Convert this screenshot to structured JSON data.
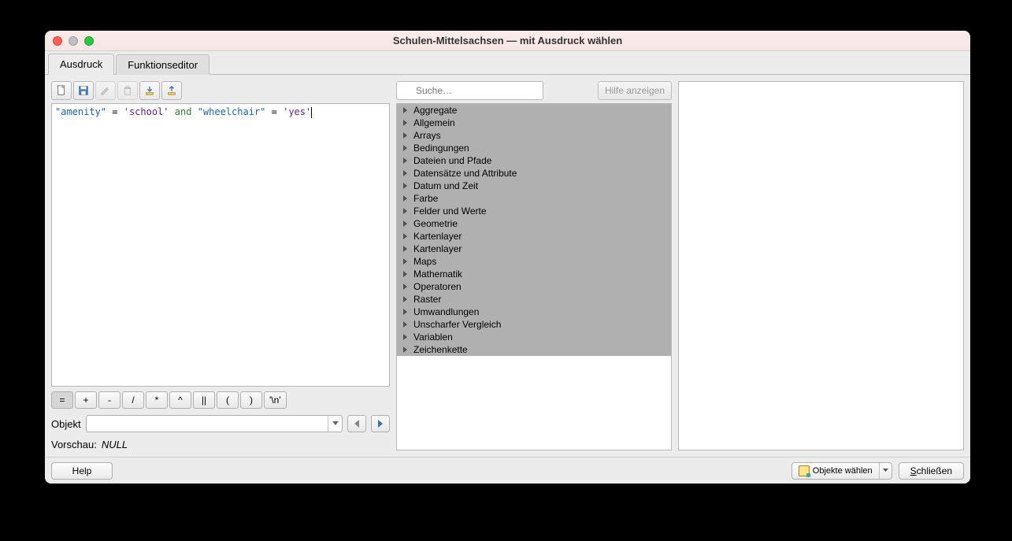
{
  "window": {
    "title": "Schulen-Mittelsachsen — mit Ausdruck wählen"
  },
  "tabs": {
    "expression": "Ausdruck",
    "function_editor": "Funktionseditor"
  },
  "expression": {
    "field1": "\"amenity\"",
    "eq1": "=",
    "str1": "'school'",
    "kw_and": "and",
    "field2": "\"wheelchair\"",
    "eq2": "=",
    "str2": "'yes'"
  },
  "operators": {
    "eq": "=",
    "plus": "+",
    "minus": "-",
    "div": "/",
    "mul": "*",
    "pow": "^",
    "concat": "||",
    "lparen": "(",
    "rparen": ")",
    "newline": "'\\n'"
  },
  "feature": {
    "label": "Objekt"
  },
  "preview": {
    "label": "Vorschau:",
    "value": "NULL"
  },
  "search": {
    "placeholder": "Suche…"
  },
  "help_show": "Hilfe anzeigen",
  "categories": [
    "Aggregate",
    "Allgemein",
    "Arrays",
    "Bedingungen",
    "Dateien und Pfade",
    "Datensätze und Attribute",
    "Datum und Zeit",
    "Farbe",
    "Felder und Werte",
    "Geometrie",
    "Kartenlayer",
    "Kartenlayer",
    "Maps",
    "Mathematik",
    "Operatoren",
    "Raster",
    "Umwandlungen",
    "Unscharfer Vergleich",
    "Variablen",
    "Zeichenkette"
  ],
  "buttons": {
    "help": "Help",
    "select_features": "Objekte wählen",
    "close": "Schließen"
  }
}
